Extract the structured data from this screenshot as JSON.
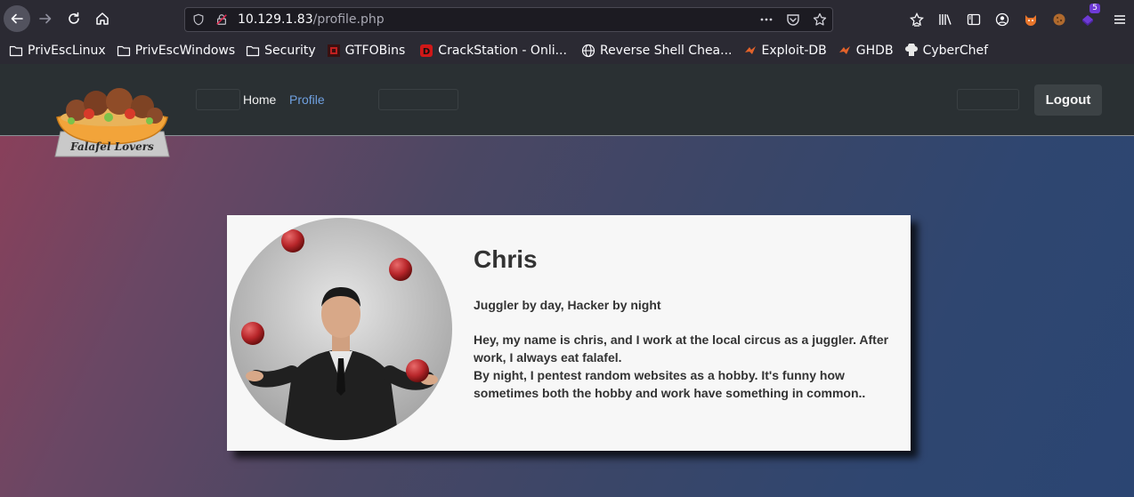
{
  "browser": {
    "url_host": "10.129.1.83",
    "url_path": "/profile.php",
    "extension_badge": "5"
  },
  "bookmarks": [
    {
      "label": "PrivEscLinux",
      "icon": "folder-icon"
    },
    {
      "label": "PrivEscWindows",
      "icon": "folder-icon"
    },
    {
      "label": "Security",
      "icon": "folder-icon"
    },
    {
      "label": "GTFOBins",
      "icon": "gtfobins-icon"
    },
    {
      "label": "CrackStation - Onli...",
      "icon": "crackstation-icon"
    },
    {
      "label": "Reverse Shell Chea...",
      "icon": "globe-icon"
    },
    {
      "label": "Exploit-DB",
      "icon": "exploitdb-icon"
    },
    {
      "label": "GHDB",
      "icon": "ghdb-icon"
    },
    {
      "label": "CyberChef",
      "icon": "cyberchef-icon"
    }
  ],
  "site": {
    "logo_text": "Falafel Lovers",
    "nav": {
      "home": "Home",
      "profile": "Profile"
    },
    "logout_label": "Logout"
  },
  "profile": {
    "name": "Chris",
    "tagline": "Juggler by day, Hacker by night",
    "bio_line1": "Hey, my name is chris, and I work at the local circus as a juggler. After work, I always eat falafel.",
    "bio_line2": "By night, I pentest random websites as a hobby. It's funny how sometimes both the hobby and work have something in common.."
  },
  "colors": {
    "accent_link": "#6fa0e0",
    "navbar_bg": "#2a3033",
    "card_bg": "#f7f7f7"
  }
}
